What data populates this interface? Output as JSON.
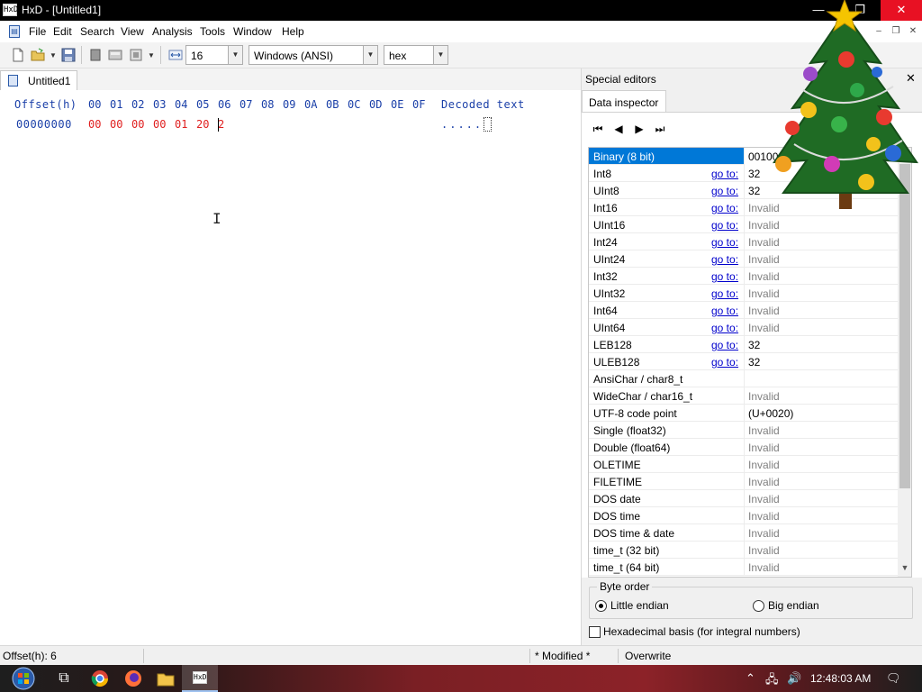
{
  "window": {
    "title": "HxD - [Untitled1]",
    "caption_min": "—",
    "caption_max": "❐",
    "caption_close": "✕",
    "app_icon": "HxD"
  },
  "menu": {
    "items": [
      "File",
      "Edit",
      "Search",
      "View",
      "Analysis",
      "Tools",
      "Window",
      "Help"
    ],
    "mdi_min": "–",
    "mdi_restore": "❐",
    "mdi_close": "✕"
  },
  "toolbar": {
    "bytes_per_row": "16",
    "charset": "Windows (ANSI)",
    "offset_base": "hex"
  },
  "document": {
    "tab_label": "Untitled1"
  },
  "hex": {
    "offset_header": "Offset(h)",
    "columns": [
      "00",
      "01",
      "02",
      "03",
      "04",
      "05",
      "06",
      "07",
      "08",
      "09",
      "0A",
      "0B",
      "0C",
      "0D",
      "0E",
      "0F"
    ],
    "decoded_header": "Decoded text",
    "row_offset": "00000000",
    "bytes": [
      "00",
      "00",
      "00",
      "00",
      "01",
      "20",
      "2"
    ],
    "decoded": ".....",
    "ibeam": "I"
  },
  "special_editors": {
    "title": "Special editors",
    "close": "✕",
    "tab": "Data inspector",
    "nav": [
      "⏮",
      "◀",
      "▶",
      "⏭"
    ],
    "rows": [
      {
        "key": "Binary (8 bit)",
        "goto": "",
        "value": "00100000",
        "invalid": false,
        "selected": true
      },
      {
        "key": "Int8",
        "goto": "go to:",
        "value": "32",
        "invalid": false
      },
      {
        "key": "UInt8",
        "goto": "go to:",
        "value": "32",
        "invalid": false
      },
      {
        "key": "Int16",
        "goto": "go to:",
        "value": "Invalid",
        "invalid": true
      },
      {
        "key": "UInt16",
        "goto": "go to:",
        "value": "Invalid",
        "invalid": true
      },
      {
        "key": "Int24",
        "goto": "go to:",
        "value": "Invalid",
        "invalid": true
      },
      {
        "key": "UInt24",
        "goto": "go to:",
        "value": "Invalid",
        "invalid": true
      },
      {
        "key": "Int32",
        "goto": "go to:",
        "value": "Invalid",
        "invalid": true
      },
      {
        "key": "UInt32",
        "goto": "go to:",
        "value": "Invalid",
        "invalid": true
      },
      {
        "key": "Int64",
        "goto": "go to:",
        "value": "Invalid",
        "invalid": true
      },
      {
        "key": "UInt64",
        "goto": "go to:",
        "value": "Invalid",
        "invalid": true
      },
      {
        "key": "LEB128",
        "goto": "go to:",
        "value": "32",
        "invalid": false
      },
      {
        "key": "ULEB128",
        "goto": "go to:",
        "value": "32",
        "invalid": false
      },
      {
        "key": "AnsiChar / char8_t",
        "goto": "",
        "value": "",
        "invalid": false
      },
      {
        "key": "WideChar / char16_t",
        "goto": "",
        "value": "Invalid",
        "invalid": true
      },
      {
        "key": "UTF-8 code point",
        "goto": "",
        "value": " (U+0020)",
        "invalid": false
      },
      {
        "key": "Single (float32)",
        "goto": "",
        "value": "Invalid",
        "invalid": true
      },
      {
        "key": "Double (float64)",
        "goto": "",
        "value": "Invalid",
        "invalid": true
      },
      {
        "key": "OLETIME",
        "goto": "",
        "value": "Invalid",
        "invalid": true
      },
      {
        "key": "FILETIME",
        "goto": "",
        "value": "Invalid",
        "invalid": true
      },
      {
        "key": "DOS date",
        "goto": "",
        "value": "Invalid",
        "invalid": true
      },
      {
        "key": "DOS time",
        "goto": "",
        "value": "Invalid",
        "invalid": true
      },
      {
        "key": "DOS time & date",
        "goto": "",
        "value": "Invalid",
        "invalid": true
      },
      {
        "key": "time_t (32 bit)",
        "goto": "",
        "value": "Invalid",
        "invalid": true
      },
      {
        "key": "time_t (64 bit)",
        "goto": "",
        "value": "Invalid",
        "invalid": true
      }
    ],
    "byte_order_label": "Byte order",
    "little_endian": "Little endian",
    "big_endian": "Big endian",
    "hex_basis": "Hexadecimal basis (for integral numbers)"
  },
  "status": {
    "offset": "Offset(h): 6",
    "modified": "* Modified *",
    "mode": "Overwrite"
  },
  "taskbar": {
    "clock": "12:48:03 AM",
    "tray_up": "⌃",
    "tray_net": "🖧",
    "tray_vol": "🔊",
    "tray_msg": "🗨"
  },
  "colors": {
    "selection": "#0078d7",
    "hex_blue": "#1a3fa8",
    "modified_red": "#e02020"
  }
}
